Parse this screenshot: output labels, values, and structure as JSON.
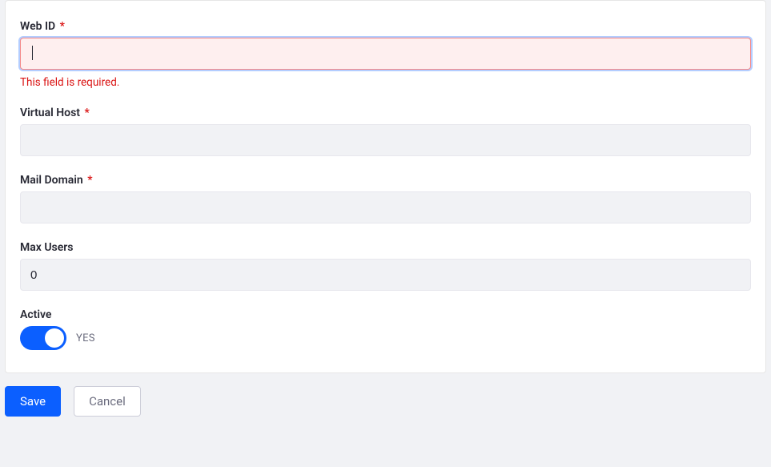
{
  "form": {
    "webId": {
      "label": "Web ID",
      "required": "*",
      "value": "",
      "error": "This field is required."
    },
    "virtualHost": {
      "label": "Virtual Host",
      "required": "*",
      "value": ""
    },
    "mailDomain": {
      "label": "Mail Domain",
      "required": "*",
      "value": ""
    },
    "maxUsers": {
      "label": "Max Users",
      "value": "0"
    },
    "active": {
      "label": "Active",
      "stateText": "YES"
    }
  },
  "buttons": {
    "save": "Save",
    "cancel": "Cancel"
  }
}
